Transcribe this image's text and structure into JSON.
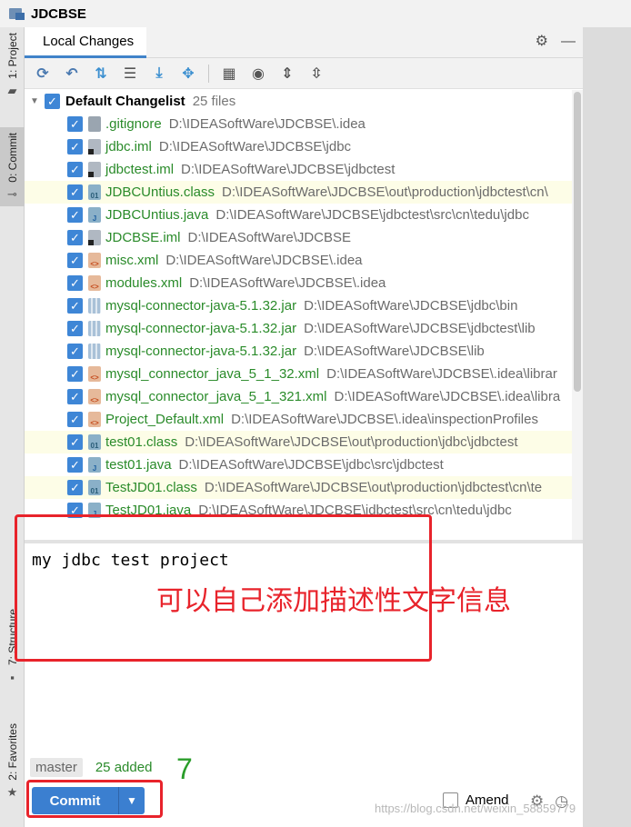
{
  "window": {
    "title": "JDCBSE"
  },
  "left_tabs": [
    {
      "label": "1: Project"
    },
    {
      "label": "0: Commit"
    },
    {
      "label": "7: Structure"
    },
    {
      "label": "2: Favorites"
    }
  ],
  "panel": {
    "tab": "Local Changes"
  },
  "changelist": {
    "name": "Default Changelist",
    "count": "25 files",
    "files": [
      {
        "name": ".gitignore",
        "path": "D:\\IDEASoftWare\\JDCBSE\\.idea",
        "type": "gray",
        "highlight": false
      },
      {
        "name": "jdbc.iml",
        "path": "D:\\IDEASoftWare\\JDCBSE\\jdbc",
        "type": "iml",
        "highlight": false
      },
      {
        "name": "jdbctest.iml",
        "path": "D:\\IDEASoftWare\\JDCBSE\\jdbctest",
        "type": "iml",
        "highlight": false
      },
      {
        "name": "JDBCUntius.class",
        "path": "D:\\IDEASoftWare\\JDCBSE\\out\\production\\jdbctest\\cn\\",
        "type": "class",
        "highlight": true
      },
      {
        "name": "JDBCUntius.java",
        "path": "D:\\IDEASoftWare\\JDCBSE\\jdbctest\\src\\cn\\tedu\\jdbc",
        "type": "java",
        "highlight": false
      },
      {
        "name": "JDCBSE.iml",
        "path": "D:\\IDEASoftWare\\JDCBSE",
        "type": "iml",
        "highlight": false
      },
      {
        "name": "misc.xml",
        "path": "D:\\IDEASoftWare\\JDCBSE\\.idea",
        "type": "xml",
        "highlight": false
      },
      {
        "name": "modules.xml",
        "path": "D:\\IDEASoftWare\\JDCBSE\\.idea",
        "type": "xml",
        "highlight": false
      },
      {
        "name": "mysql-connector-java-5.1.32.jar",
        "path": "D:\\IDEASoftWare\\JDCBSE\\jdbc\\bin",
        "type": "jar",
        "highlight": false
      },
      {
        "name": "mysql-connector-java-5.1.32.jar",
        "path": "D:\\IDEASoftWare\\JDCBSE\\jdbctest\\lib",
        "type": "jar",
        "highlight": false
      },
      {
        "name": "mysql-connector-java-5.1.32.jar",
        "path": "D:\\IDEASoftWare\\JDCBSE\\lib",
        "type": "jar",
        "highlight": false
      },
      {
        "name": "mysql_connector_java_5_1_32.xml",
        "path": "D:\\IDEASoftWare\\JDCBSE\\.idea\\librar",
        "type": "xml",
        "highlight": false
      },
      {
        "name": "mysql_connector_java_5_1_321.xml",
        "path": "D:\\IDEASoftWare\\JDCBSE\\.idea\\libra",
        "type": "xml",
        "highlight": false
      },
      {
        "name": "Project_Default.xml",
        "path": "D:\\IDEASoftWare\\JDCBSE\\.idea\\inspectionProfiles",
        "type": "xml",
        "highlight": false
      },
      {
        "name": "test01.class",
        "path": "D:\\IDEASoftWare\\JDCBSE\\out\\production\\jdbc\\jdbctest",
        "type": "class",
        "highlight": true
      },
      {
        "name": "test01.java",
        "path": "D:\\IDEASoftWare\\JDCBSE\\jdbc\\src\\jdbctest",
        "type": "java",
        "highlight": false
      },
      {
        "name": "TestJD01.class",
        "path": "D:\\IDEASoftWare\\JDCBSE\\out\\production\\jdbctest\\cn\\te",
        "type": "class",
        "highlight": true
      },
      {
        "name": "TestJD01.java",
        "path": "D:\\IDEASoftWare\\JDCBSE\\jdbctest\\src\\cn\\tedu\\jdbc",
        "type": "java",
        "highlight": false
      }
    ]
  },
  "commit_message": "my jdbc test project",
  "annotation_text": "可以自己添加描述性文字信息",
  "step_number": "7",
  "status": {
    "branch": "master",
    "added": "25 added"
  },
  "commit_button": {
    "label": "Commit"
  },
  "amend": {
    "label": "Amend"
  },
  "watermark": "https://blog.csdn.net/weixin_58859779"
}
